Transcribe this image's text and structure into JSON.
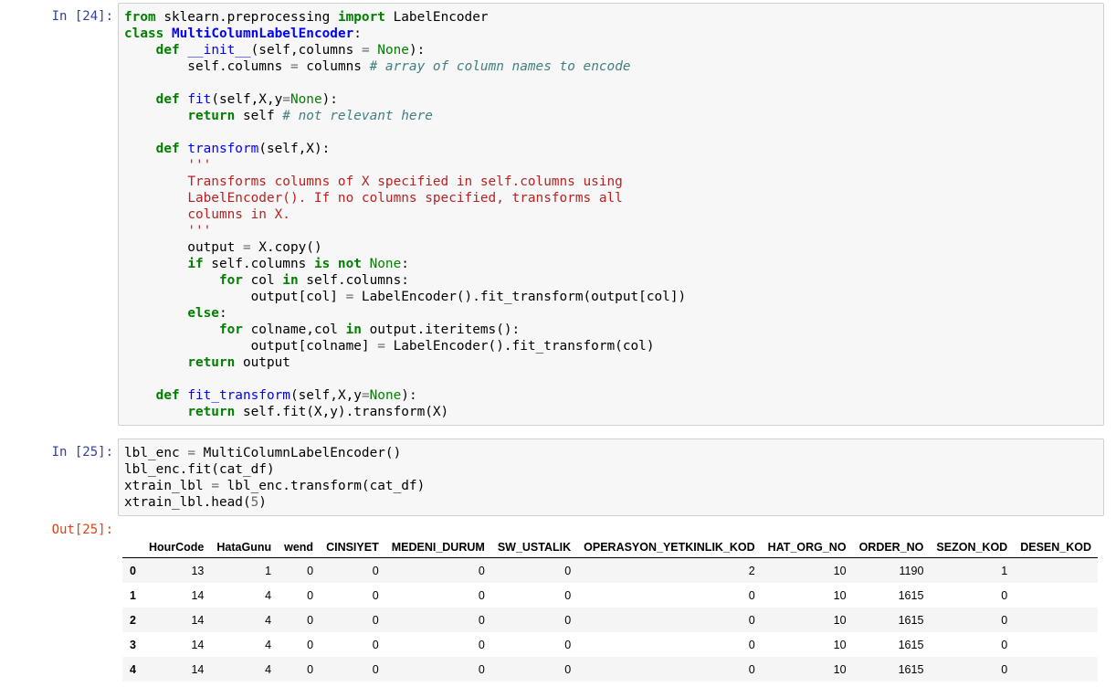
{
  "cells": [
    {
      "prompt": "In [24]:"
    },
    {
      "prompt": "In [25]:"
    },
    {
      "prompt": "Out[25]:"
    }
  ],
  "code24": [
    [
      "from",
      " sklearn.preprocessing ",
      "import",
      " LabelEncoder"
    ],
    [
      "class",
      " ",
      "MultiColumnLabelEncoder",
      ":"
    ],
    [
      "    ",
      "def",
      " ",
      "__init__",
      "(self,columns ",
      "=",
      " ",
      "None",
      "):"
    ],
    [
      "        self.columns ",
      "=",
      " columns ",
      "# array of column names to encode"
    ],
    [
      ""
    ],
    [
      "    ",
      "def",
      " ",
      "fit",
      "(self,X,y",
      "=",
      "None",
      "):"
    ],
    [
      "        ",
      "return",
      " self ",
      "# not relevant here"
    ],
    [
      ""
    ],
    [
      "    ",
      "def",
      " ",
      "transform",
      "(self,X):"
    ],
    [
      "        ",
      "'''"
    ],
    [
      "        ",
      "Transforms columns of X specified in self.columns using"
    ],
    [
      "        ",
      "LabelEncoder(). If no columns specified, transforms all"
    ],
    [
      "        ",
      "columns in X."
    ],
    [
      "        ",
      "'''"
    ],
    [
      "        output ",
      "=",
      " X.copy()"
    ],
    [
      "        ",
      "if",
      " self.columns ",
      "is not",
      " ",
      "None",
      ":"
    ],
    [
      "            ",
      "for",
      " col ",
      "in",
      " self.columns:"
    ],
    [
      "                output[col] ",
      "=",
      " LabelEncoder().fit_transform(output[col])"
    ],
    [
      "        ",
      "else",
      ":"
    ],
    [
      "            ",
      "for",
      " colname,col ",
      "in",
      " output.iteritems():"
    ],
    [
      "                output[colname] ",
      "=",
      " LabelEncoder().fit_transform(col)"
    ],
    [
      "        ",
      "return",
      " output"
    ],
    [
      ""
    ],
    [
      "    ",
      "def",
      " ",
      "fit_transform",
      "(self,X,y",
      "=",
      "None",
      "):"
    ],
    [
      "        ",
      "return",
      " self.fit(X,y).transform(X)"
    ]
  ],
  "code25": [
    [
      "lbl_enc ",
      "=",
      " MultiColumnLabelEncoder()"
    ],
    [
      "lbl_enc.fit(cat_df)"
    ],
    [
      "xtrain_lbl ",
      "=",
      " lbl_enc.transform(cat_df)"
    ],
    [
      "xtrain_lbl.head(",
      "5",
      ")"
    ]
  ],
  "table": {
    "columns": [
      "",
      "HourCode",
      "HataGunu",
      "wend",
      "CINSIYET",
      "MEDENI_DURUM",
      "SW_USTALIK",
      "OPERASYON_YETKINLIK_KOD",
      "HAT_ORG_NO",
      "ORDER_NO",
      "SEZON_KOD",
      "DESEN_KOD"
    ],
    "rows": [
      [
        "0",
        "13",
        "1",
        "0",
        "0",
        "0",
        "0",
        "2",
        "10",
        "1190",
        "1",
        ""
      ],
      [
        "1",
        "14",
        "4",
        "0",
        "0",
        "0",
        "0",
        "0",
        "10",
        "1615",
        "0",
        ""
      ],
      [
        "2",
        "14",
        "4",
        "0",
        "0",
        "0",
        "0",
        "0",
        "10",
        "1615",
        "0",
        ""
      ],
      [
        "3",
        "14",
        "4",
        "0",
        "0",
        "0",
        "0",
        "0",
        "10",
        "1615",
        "0",
        ""
      ],
      [
        "4",
        "14",
        "4",
        "0",
        "0",
        "0",
        "0",
        "0",
        "10",
        "1615",
        "0",
        ""
      ]
    ]
  }
}
